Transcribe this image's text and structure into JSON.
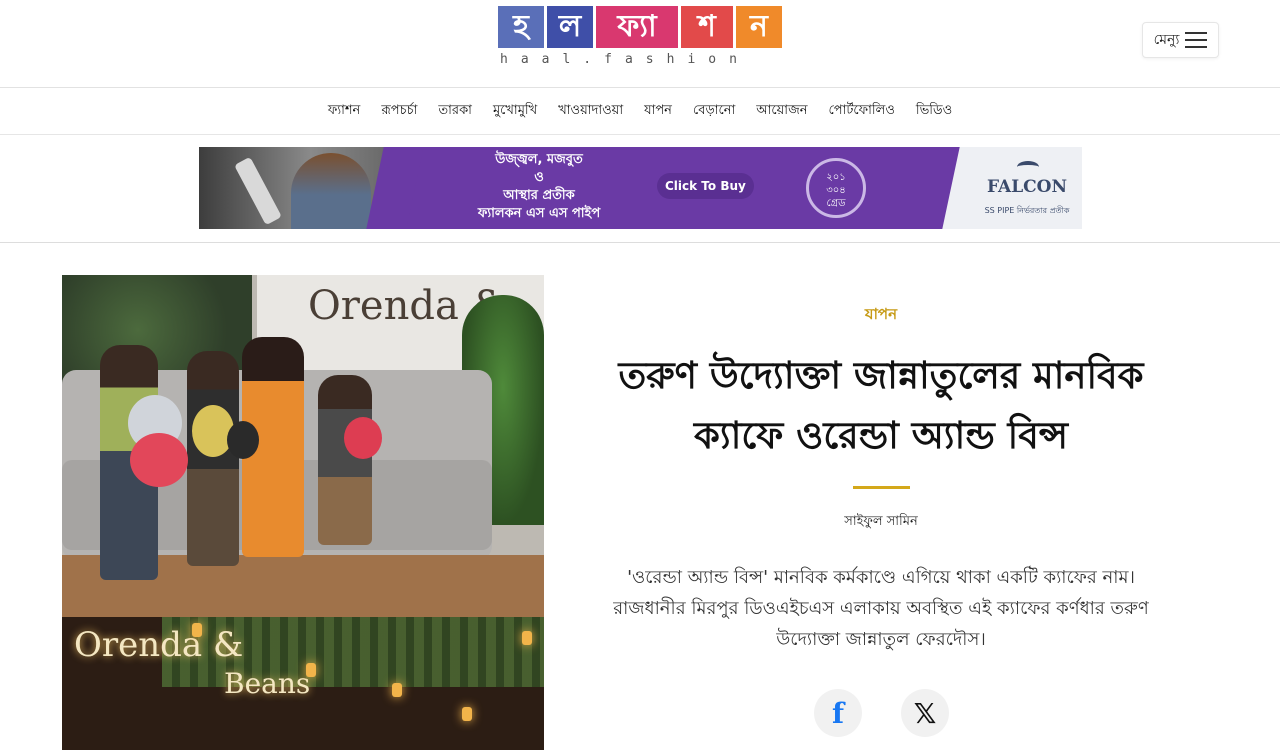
{
  "header": {
    "logo_blocks": [
      {
        "glyph": "হ",
        "color": "#5a6fb8"
      },
      {
        "glyph": "ল",
        "color": "#3f4fa8"
      },
      {
        "glyph": "ফ্যা",
        "color": "#d9386f"
      },
      {
        "glyph": "শ",
        "color": "#e24a4a"
      },
      {
        "glyph": "ন",
        "color": "#f08a2a"
      }
    ],
    "logo_sub": "haal.fashion",
    "menu_label": "মেন্যু"
  },
  "nav": {
    "items": [
      "ফ্যাশন",
      "রূপচর্চা",
      "তারকা",
      "মুখোমুখি",
      "খাওয়াদাওয়া",
      "যাপন",
      "বেড়ানো",
      "আয়োজন",
      "পোর্টফোলিও",
      "ভিডিও"
    ]
  },
  "ad": {
    "headline_1": "উজ্জ্বল, মজবুত",
    "headline_2": "ও",
    "headline_3": "আস্থার প্রতীক",
    "headline_4": "ফ্যালকন এস এস পাইপ",
    "cta": "Click To Buy",
    "seal_1": "২০১",
    "seal_2": "৩০৪",
    "seal_3": "গ্রেড",
    "brand": "FALCON",
    "brand_tag": "SS PIPE",
    "brand_sub": "নির্ভরতার প্রতীক"
  },
  "hero": {
    "image1_sign": "Orenda &",
    "image2_sign": "Orenda &",
    "image2_sign2": "Beans"
  },
  "article": {
    "category": "যাপন",
    "title": "তরুণ উদ্যোক্তা জান্নাতুলের মানবিক ক্যাফে ওরেন্ডা অ্যান্ড বিন্স",
    "author": "সাইফুল সামিন",
    "summary": "'ওরেন্ডা অ্যান্ড বিন্স' মানবিক কর্মকাণ্ডে এগিয়ে থাকা একটি ক্যাফের নাম। রাজধানীর মিরপুর ডিওএইচএস এলাকায় অবস্থিত এই ক্যাফের কর্ণধার তরুণ উদ্যোক্তা জান্নাতুল ফেরদৌস।"
  },
  "share": {
    "facebook_glyph": "f",
    "x_glyph": "𝕏"
  },
  "colors": {
    "accent": "#c69a14",
    "ad_purple": "#6a3aa5"
  }
}
